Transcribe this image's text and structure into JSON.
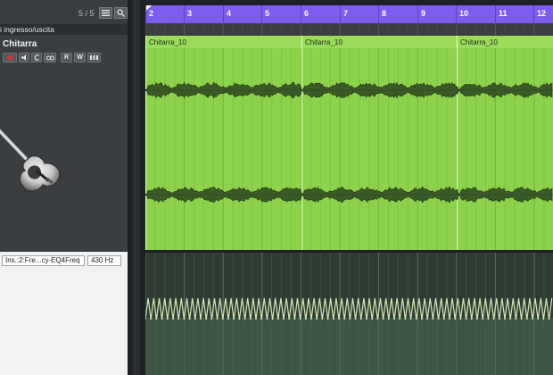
{
  "left_panel": {
    "track_counter": "5 / 5",
    "io_section_label": "i ingresso/uscita",
    "track": {
      "name": "Chitarra",
      "buttons": [
        {
          "icon": "record-icon",
          "label": ""
        },
        {
          "icon": "monitor-icon",
          "label": ""
        },
        {
          "icon": "read-automation-icon",
          "label": ""
        },
        {
          "icon": "edit-channel-icon",
          "label": ""
        },
        {
          "icon": "read-icon",
          "label": "R"
        },
        {
          "icon": "write-icon",
          "label": "W"
        },
        {
          "icon": "more-icon",
          "label": ""
        }
      ]
    },
    "automation_lane": {
      "parameter": "Ins.:2:Fre...cy-EQ4Freq",
      "value": "430 Hz"
    }
  },
  "ruler": {
    "bars": [
      "2",
      "3",
      "4",
      "5",
      "6",
      "7",
      "8",
      "9",
      "10",
      "11",
      "12"
    ]
  },
  "events": [
    {
      "name": "Chitarra_10"
    },
    {
      "name": "Chitarra_10"
    },
    {
      "name": "Chitarra_10"
    }
  ],
  "colors": {
    "ruler": "#7d5cf0",
    "audio_event": "#8cd24a",
    "waveform": "#2e4a22",
    "automation_line": "#cfe8b0",
    "record_button": "#d93030"
  }
}
